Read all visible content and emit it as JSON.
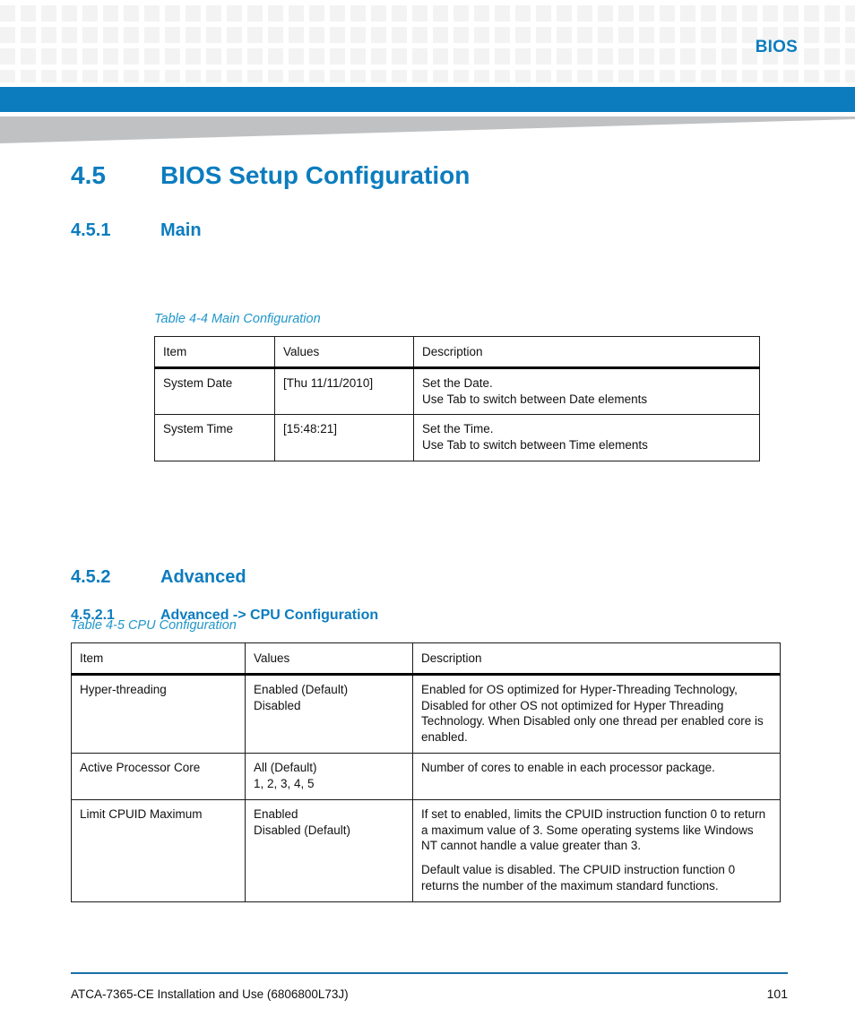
{
  "header": {
    "label": "BIOS"
  },
  "headings": {
    "h1_number": "4.5",
    "h1_title": "BIOS Setup Configuration",
    "h2_number": "4.5.1",
    "h2_title": "Main",
    "h2b_number": "4.5.2",
    "h2b_title": "Advanced",
    "h3_number": "4.5.2.1",
    "h3_title": "Advanced -> CPU Configuration"
  },
  "table1": {
    "caption": "Table 4-4 Main Configuration",
    "columns": [
      "Item",
      "Values",
      "Description"
    ],
    "rows": [
      {
        "item": "System Date",
        "values": "[Thu 11/11/2010]",
        "desc_line1": "Set the Date.",
        "desc_line2": "Use Tab to switch between Date elements"
      },
      {
        "item": "System Time",
        "values": "[15:48:21]",
        "desc_line1": "Set the Time.",
        "desc_line2": "Use Tab to switch between Time elements"
      }
    ]
  },
  "table2": {
    "caption": "Table 4-5 CPU Configuration",
    "columns": [
      "Item",
      "Values",
      "Description"
    ],
    "rows": [
      {
        "item": "Hyper-threading",
        "values_line1": "Enabled (Default)",
        "values_line2": "Disabled",
        "desc_para1": "Enabled for OS optimized for Hyper-Threading Technology, Disabled for other OS not optimized for Hyper Threading Technology. When Disabled only one thread per enabled core is enabled.",
        "desc_para2": ""
      },
      {
        "item": "Active Processor Core",
        "values_line1": "All (Default)",
        "values_line2": "1, 2, 3, 4, 5",
        "desc_para1": "Number of cores to enable in each processor package.",
        "desc_para2": ""
      },
      {
        "item": "Limit CPUID Maximum",
        "values_line1": "Enabled",
        "values_line2": "Disabled (Default)",
        "desc_para1": "If set to enabled, limits the CPUID instruction function 0 to return a maximum value of 3. Some operating systems like Windows NT cannot handle a value greater than 3.",
        "desc_para2": "Default value is disabled. The CPUID instruction function 0 returns the number of the maximum standard functions."
      }
    ]
  },
  "footer": {
    "document_title": "ATCA-7365-CE Installation and Use (6806800L73J)",
    "page_number": "101"
  },
  "colors": {
    "brand_blue": "#0c7cbe",
    "caption_blue": "#2196c9",
    "footer_rule_blue": "#1a6fa8",
    "header_square_gray": "#f3f3f3",
    "wedge_gray": "#bfc1c3"
  }
}
